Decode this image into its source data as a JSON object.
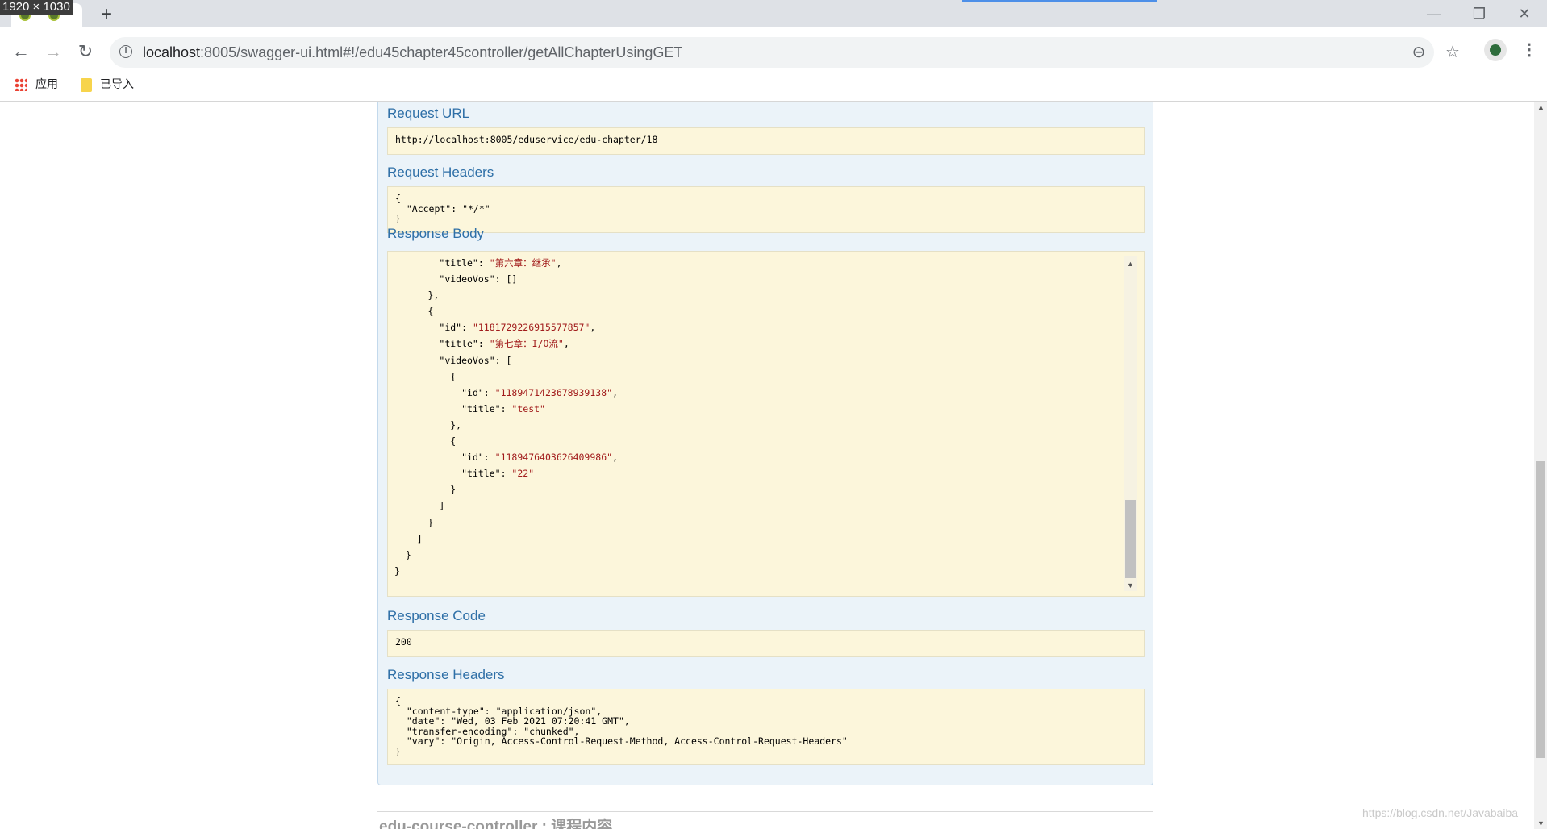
{
  "screen_label": "1920 × 1030",
  "browser": {
    "new_tab_symbol": "+",
    "window_controls": {
      "minimize": "—",
      "restore": "❐",
      "close": "✕"
    },
    "nav": {
      "back": "←",
      "forward": "→",
      "reload": "↻"
    },
    "url_host": "localhost",
    "url_rest": ":8005/swagger-ui.html#!/edu45chapter45controller/getAllChapterUsingGET",
    "zoom_symbol": "⊖",
    "star_symbol": "☆",
    "menu_symbol": "⋮",
    "bookmarks": [
      {
        "label": "应用",
        "icon": "apps-grid-icon"
      },
      {
        "label": "已导入",
        "icon": "folder-icon"
      }
    ]
  },
  "swagger": {
    "request_url_title": "Request URL",
    "request_url": "http://localhost:8005/eduservice/edu-chapter/18",
    "request_headers_title": "Request Headers",
    "request_headers": "{\n  \"Accept\": \"*/*\"\n}",
    "response_body_title": "Response Body",
    "response_body_lines": [
      {
        "indent": "        ",
        "key": "\"title\"",
        "sep": ": ",
        "val": "\"第六章：继承\"",
        "tail": ","
      },
      {
        "indent": "        ",
        "key": "\"videoVos\"",
        "sep": ": []",
        "val": "",
        "tail": ""
      },
      {
        "indent": "      ",
        "key": "},",
        "sep": "",
        "val": "",
        "tail": ""
      },
      {
        "indent": "      ",
        "key": "{",
        "sep": "",
        "val": "",
        "tail": ""
      },
      {
        "indent": "        ",
        "key": "\"id\"",
        "sep": ": ",
        "val": "\"1181729226915577857\"",
        "tail": ","
      },
      {
        "indent": "        ",
        "key": "\"title\"",
        "sep": ": ",
        "val": "\"第七章：I/O流\"",
        "tail": ","
      },
      {
        "indent": "        ",
        "key": "\"videoVos\"",
        "sep": ": [",
        "val": "",
        "tail": ""
      },
      {
        "indent": "          ",
        "key": "{",
        "sep": "",
        "val": "",
        "tail": ""
      },
      {
        "indent": "            ",
        "key": "\"id\"",
        "sep": ": ",
        "val": "\"1189471423678939138\"",
        "tail": ","
      },
      {
        "indent": "            ",
        "key": "\"title\"",
        "sep": ": ",
        "val": "\"test\"",
        "tail": ""
      },
      {
        "indent": "          ",
        "key": "},",
        "sep": "",
        "val": "",
        "tail": ""
      },
      {
        "indent": "          ",
        "key": "{",
        "sep": "",
        "val": "",
        "tail": ""
      },
      {
        "indent": "            ",
        "key": "\"id\"",
        "sep": ": ",
        "val": "\"1189476403626409986\"",
        "tail": ","
      },
      {
        "indent": "            ",
        "key": "\"title\"",
        "sep": ": ",
        "val": "\"22\"",
        "tail": ""
      },
      {
        "indent": "          ",
        "key": "}",
        "sep": "",
        "val": "",
        "tail": ""
      },
      {
        "indent": "        ",
        "key": "]",
        "sep": "",
        "val": "",
        "tail": ""
      },
      {
        "indent": "      ",
        "key": "}",
        "sep": "",
        "val": "",
        "tail": ""
      },
      {
        "indent": "    ",
        "key": "]",
        "sep": "",
        "val": "",
        "tail": ""
      },
      {
        "indent": "  ",
        "key": "}",
        "sep": "",
        "val": "",
        "tail": ""
      },
      {
        "indent": "",
        "key": "}",
        "sep": "",
        "val": "",
        "tail": ""
      }
    ],
    "response_code_title": "Response Code",
    "response_code": "200",
    "response_headers_title": "Response Headers",
    "response_headers": "{\n  \"content-type\": \"application/json\",\n  \"date\": \"Wed, 03 Feb 2021 07:20:41 GMT\",\n  \"transfer-encoding\": \"chunked\",\n  \"vary\": \"Origin, Access-Control-Request-Method, Access-Control-Request-Headers\"\n}",
    "next_section_heading": "edu-course-controller : 课程内容"
  },
  "watermark": "https://blog.csdn.net/Javabaiba"
}
